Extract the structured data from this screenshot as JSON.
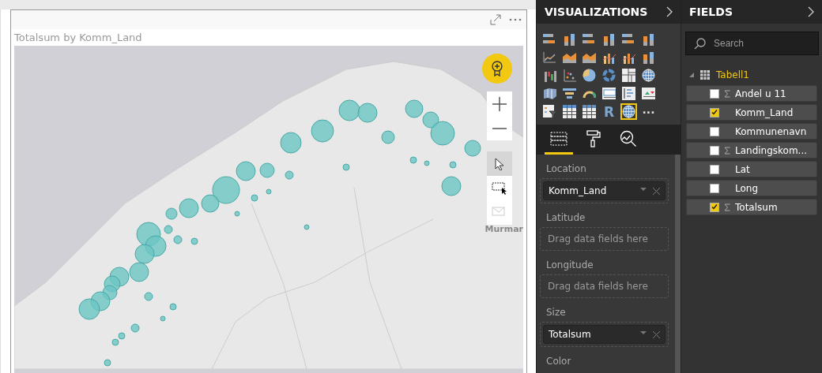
{
  "visual": {
    "title": "Totalsum by Komm_Land",
    "map_label": "Murmar"
  },
  "visualizations": {
    "title": "VISUALIZATIONS",
    "types": [
      {
        "kind": "hbar",
        "selected": false
      },
      {
        "kind": "column",
        "selected": false
      },
      {
        "kind": "hbar",
        "selected": false
      },
      {
        "kind": "column",
        "selected": false
      },
      {
        "kind": "hbar",
        "selected": false
      },
      {
        "kind": "column",
        "selected": false
      },
      {
        "kind": "line",
        "selected": false
      },
      {
        "kind": "area",
        "selected": false
      },
      {
        "kind": "area",
        "selected": false
      },
      {
        "kind": "combo",
        "selected": false
      },
      {
        "kind": "combo",
        "selected": false
      },
      {
        "kind": "column",
        "selected": false
      },
      {
        "kind": "waterfall",
        "selected": false
      },
      {
        "kind": "scatter",
        "selected": false
      },
      {
        "kind": "pie",
        "selected": false
      },
      {
        "kind": "donut",
        "selected": false
      },
      {
        "kind": "treemap",
        "selected": false
      },
      {
        "kind": "globe",
        "selected": false
      },
      {
        "kind": "filled-map",
        "selected": false
      },
      {
        "kind": "funnel",
        "selected": false
      },
      {
        "kind": "gauge",
        "selected": false
      },
      {
        "kind": "card",
        "selected": false
      },
      {
        "kind": "multirow",
        "selected": false
      },
      {
        "kind": "kpi",
        "selected": false
      },
      {
        "kind": "slicer",
        "selected": false
      },
      {
        "kind": "table",
        "selected": false
      },
      {
        "kind": "table",
        "selected": false
      },
      {
        "kind": "r",
        "label": "R",
        "selected": false
      },
      {
        "kind": "globe",
        "selected": true
      }
    ],
    "more": "···",
    "pane_tabs": [
      {
        "kind": "fields",
        "selected": true
      },
      {
        "kind": "format",
        "selected": false
      },
      {
        "kind": "analytics",
        "selected": false
      }
    ],
    "wells": [
      {
        "label": "Location",
        "value": "Komm_Land"
      },
      {
        "label": "Latitude",
        "placeholder": "Drag data fields here"
      },
      {
        "label": "Longitude",
        "placeholder": "Drag data fields here"
      },
      {
        "label": "Size",
        "value": "Totalsum"
      },
      {
        "label": "Color"
      }
    ]
  },
  "fields": {
    "title": "FIELDS",
    "search": {
      "placeholder": "Search"
    },
    "tables": [
      {
        "name": "Tabell1",
        "expanded": true,
        "children": [
          {
            "name": "Andel u 11",
            "checked": false,
            "sum": true
          },
          {
            "name": "Komm_Land",
            "checked": true,
            "sum": false
          },
          {
            "name": "Kommunenavn",
            "checked": false,
            "sum": false
          },
          {
            "name": "Landingskom...",
            "checked": false,
            "sum": true
          },
          {
            "name": "Lat",
            "checked": false,
            "sum": false
          },
          {
            "name": "Long",
            "checked": false,
            "sum": false
          },
          {
            "name": "Totalsum",
            "checked": true,
            "sum": true
          }
        ]
      }
    ]
  }
}
